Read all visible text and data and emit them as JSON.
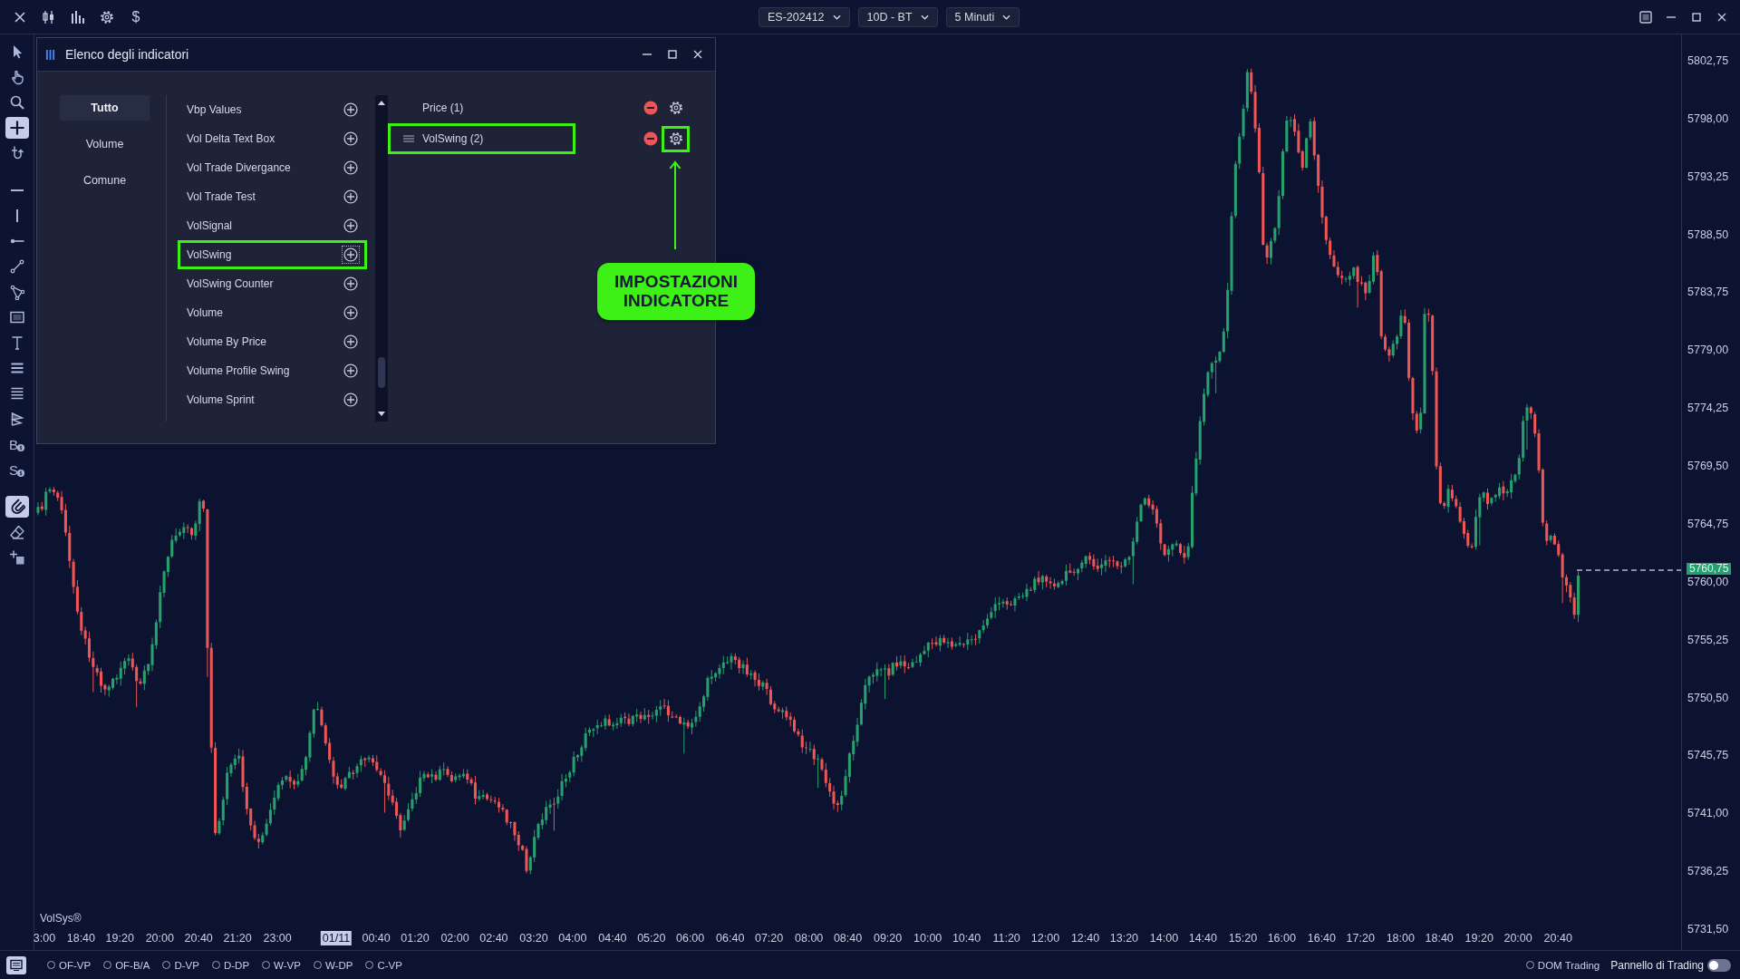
{
  "top_bar": {
    "currency_symbol": "$",
    "selectors": [
      {
        "label": "ES-202412"
      },
      {
        "label": "10D - BT"
      },
      {
        "label": "5 Minuti"
      }
    ]
  },
  "left_toolbar": {
    "groups": [
      {
        "tools": [
          {
            "kind": "pointer",
            "selected": false
          },
          {
            "kind": "hand",
            "selected": false
          },
          {
            "kind": "zoom",
            "selected": false
          },
          {
            "kind": "crosshair",
            "selected": true
          },
          {
            "kind": "u-turn",
            "selected": false
          }
        ]
      },
      {
        "tools": [
          {
            "kind": "hline",
            "selected": false
          },
          {
            "kind": "vline",
            "selected": false
          },
          {
            "kind": "ray",
            "selected": false
          },
          {
            "kind": "trendline",
            "selected": false
          },
          {
            "kind": "channel",
            "selected": false
          },
          {
            "kind": "rectangle",
            "selected": false
          },
          {
            "kind": "text",
            "selected": false
          },
          {
            "kind": "three-lines",
            "selected": false
          },
          {
            "kind": "four-lines",
            "selected": false
          },
          {
            "kind": "zigzag",
            "selected": false
          },
          {
            "kind": "order",
            "letter": "B",
            "selected": false
          },
          {
            "kind": "order",
            "letter": "S",
            "selected": false
          }
        ]
      },
      {
        "tools": [
          {
            "kind": "magnet",
            "selected": true
          },
          {
            "kind": "eraser",
            "selected": false
          },
          {
            "kind": "add",
            "selected": false
          }
        ]
      }
    ]
  },
  "dialog": {
    "title": "Elenco degli indicatori",
    "categories": [
      {
        "label": "Tutto",
        "selected": true
      },
      {
        "label": "Volume",
        "selected": false
      },
      {
        "label": "Comune",
        "selected": false
      }
    ],
    "indicators": [
      {
        "name": "Vbp Values",
        "highlighted": false,
        "focused": false
      },
      {
        "name": "Vol Delta Text Box",
        "highlighted": false,
        "focused": false
      },
      {
        "name": "Vol Trade Divergance",
        "highlighted": false,
        "focused": false
      },
      {
        "name": "Vol Trade Test",
        "highlighted": false,
        "focused": false
      },
      {
        "name": "VolSignal",
        "highlighted": false,
        "focused": false
      },
      {
        "name": "VolSwing",
        "highlighted": true,
        "focused": true
      },
      {
        "name": "VolSwing Counter",
        "highlighted": false,
        "focused": false
      },
      {
        "name": "Volume",
        "highlighted": false,
        "focused": false
      },
      {
        "name": "Volume By Price",
        "highlighted": false,
        "focused": false
      },
      {
        "name": "Volume Profile Swing",
        "highlighted": false,
        "focused": false
      },
      {
        "name": "Volume Sprint",
        "highlighted": false,
        "focused": false
      }
    ],
    "active_indicators": [
      {
        "name": "Price (1)",
        "drag_handle": false,
        "highlighted": false,
        "settings_highlighted": false
      },
      {
        "name": "VolSwing (2)",
        "drag_handle": true,
        "highlighted": true,
        "settings_highlighted": true
      }
    ]
  },
  "annotation": {
    "text": "IMPOSTAZIONI\nINDICATORE"
  },
  "chart": {
    "brand_label": "VolSys®"
  },
  "price_axis": {
    "labels": [
      "5802,75",
      "5798,00",
      "5793,25",
      "5788,50",
      "5783,75",
      "5779,00",
      "5774,25",
      "5769,50",
      "5764,75",
      "5760,00",
      "5755,25",
      "5750,50",
      "5745,75",
      "5741,00",
      "5736,25",
      "5731,50"
    ],
    "last_price": "5760,75"
  },
  "time_axis": {
    "labels": [
      {
        "text": "3:00",
        "kind": "time"
      },
      {
        "text": "18:40",
        "kind": "time"
      },
      {
        "text": "19:20",
        "kind": "time"
      },
      {
        "text": "20:00",
        "kind": "time"
      },
      {
        "text": "20:40",
        "kind": "time"
      },
      {
        "text": "21:20",
        "kind": "time"
      },
      {
        "text": "23:00",
        "kind": "time"
      },
      {
        "text": "01/11",
        "kind": "date"
      },
      {
        "text": "00:40",
        "kind": "time"
      },
      {
        "text": "01:20",
        "kind": "time"
      },
      {
        "text": "02:00",
        "kind": "time"
      },
      {
        "text": "02:40",
        "kind": "time"
      },
      {
        "text": "03:20",
        "kind": "time"
      },
      {
        "text": "04:00",
        "kind": "time"
      },
      {
        "text": "04:40",
        "kind": "time"
      },
      {
        "text": "05:20",
        "kind": "time"
      },
      {
        "text": "06:00",
        "kind": "time"
      },
      {
        "text": "06:40",
        "kind": "time"
      },
      {
        "text": "07:20",
        "kind": "time"
      },
      {
        "text": "08:00",
        "kind": "time"
      },
      {
        "text": "08:40",
        "kind": "time"
      },
      {
        "text": "09:20",
        "kind": "time"
      },
      {
        "text": "10:00",
        "kind": "time"
      },
      {
        "text": "10:40",
        "kind": "time"
      },
      {
        "text": "11:20",
        "kind": "time"
      },
      {
        "text": "12:00",
        "kind": "time"
      },
      {
        "text": "12:40",
        "kind": "time"
      },
      {
        "text": "13:20",
        "kind": "time"
      },
      {
        "text": "14:00",
        "kind": "time"
      },
      {
        "text": "14:40",
        "kind": "time"
      },
      {
        "text": "15:20",
        "kind": "time"
      },
      {
        "text": "16:00",
        "kind": "time"
      },
      {
        "text": "16:40",
        "kind": "time"
      },
      {
        "text": "17:20",
        "kind": "time"
      },
      {
        "text": "18:00",
        "kind": "time"
      },
      {
        "text": "18:40",
        "kind": "time"
      },
      {
        "text": "19:20",
        "kind": "time"
      },
      {
        "text": "20:00",
        "kind": "time"
      },
      {
        "text": "20:40",
        "kind": "time"
      }
    ]
  },
  "bottom_bar": {
    "console_selected": true,
    "studies": [
      {
        "label": "OF-VP",
        "selected": false
      },
      {
        "label": "OF-B/A",
        "selected": false
      },
      {
        "label": "D-VP",
        "selected": false
      },
      {
        "label": "D-DP",
        "selected": false
      },
      {
        "label": "W-VP",
        "selected": false
      },
      {
        "label": "W-DP",
        "selected": false
      },
      {
        "label": "C-VP",
        "selected": false
      }
    ],
    "dom_trading": {
      "label": "DOM Trading",
      "selected": false
    },
    "trading_panel": {
      "label": "Pannello di Trading",
      "on": false
    }
  }
}
